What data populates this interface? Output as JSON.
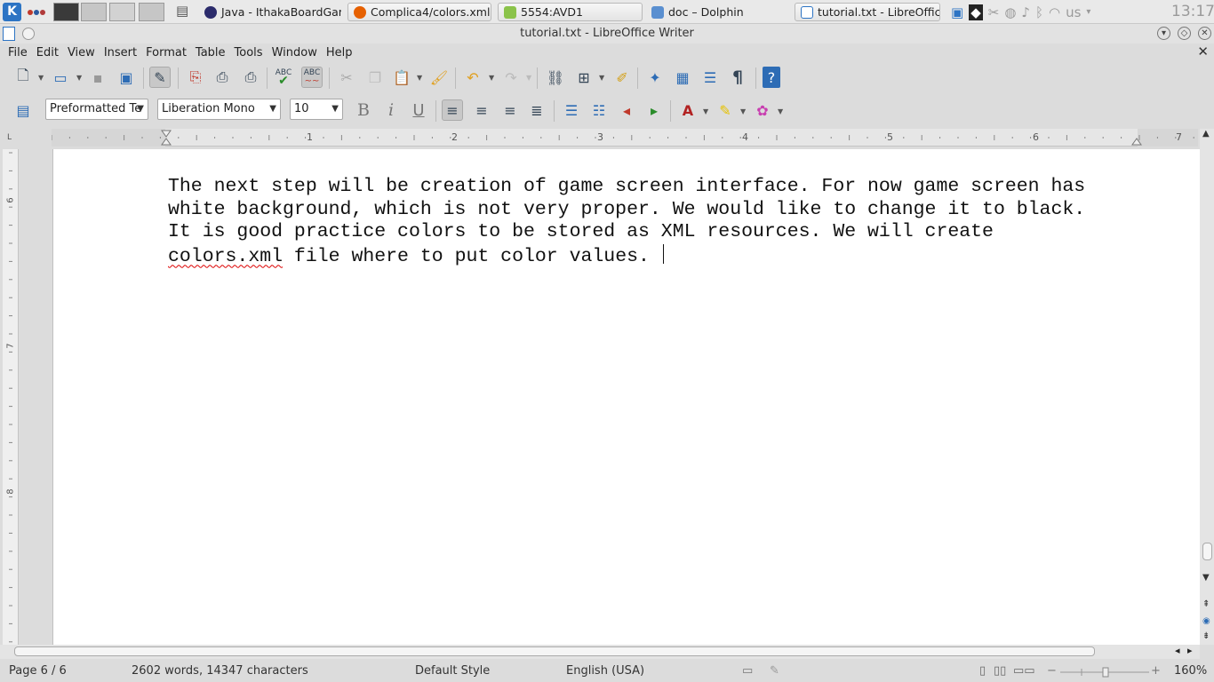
{
  "taskbar": {
    "kmenu_label": "K",
    "tasks": [
      {
        "label": "Java - IthakaBoardGam"
      },
      {
        "label": "Complica4/colors.xml a"
      },
      {
        "label": "5554:AVD1"
      },
      {
        "label": "doc – Dolphin"
      },
      {
        "label": "tutorial.txt - LibreOffic"
      }
    ],
    "keyboard_layout": "us",
    "clock": "13:17"
  },
  "window": {
    "title": "tutorial.txt - LibreOffice Writer"
  },
  "menubar": {
    "items": [
      {
        "label": "File"
      },
      {
        "label": "Edit"
      },
      {
        "label": "View"
      },
      {
        "label": "Insert"
      },
      {
        "label": "Format"
      },
      {
        "label": "Table"
      },
      {
        "label": "Tools"
      },
      {
        "label": "Window"
      },
      {
        "label": "Help"
      }
    ],
    "close_glyph": "✕"
  },
  "toolbar_standard": {
    "spellcheck_label": "ABC",
    "autospell_label": "ABC",
    "formatting_marks_glyph": "¶",
    "help_glyph": "?"
  },
  "toolbar_formatting": {
    "paragraph_style": "Preformatted Te",
    "font_name": "Liberation Mono",
    "font_size": "10",
    "bold_label": "B",
    "italic_label": "i",
    "underline_label": "U"
  },
  "ruler": {
    "corner": "L",
    "h_numbers": [
      "1",
      "2",
      "3",
      "4",
      "5",
      "6",
      "7"
    ],
    "v_numbers": [
      "6",
      "7",
      "8"
    ]
  },
  "document": {
    "lines": [
      {
        "text": "The next step will be creation of game screen interface. For now game screen has"
      },
      {
        "text": "white background, which is not very proper. We would like to change it to black."
      },
      {
        "text": "It is good practice colors to be stored as XML resources. We will create"
      }
    ],
    "last_line_misspelled": "colors.xml",
    "last_line_rest": " file where to put color values. "
  },
  "statusbar": {
    "page": "Page 6 / 6",
    "word_count": "2602 words, 14347 characters",
    "page_style": "Default Style",
    "language": "English (USA)",
    "zoom": "160%"
  }
}
